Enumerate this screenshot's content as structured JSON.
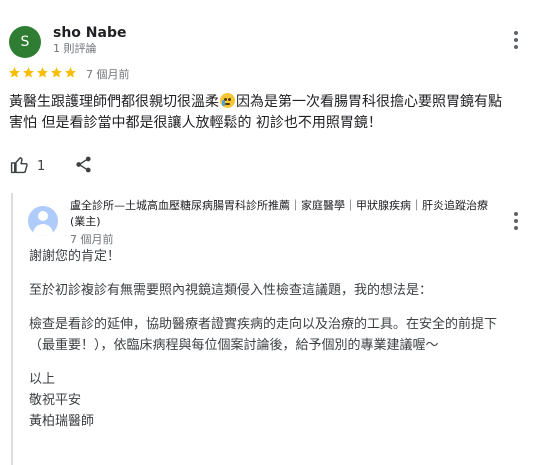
{
  "review": {
    "avatar_letter": "S",
    "avatar_color": "#2e7d32",
    "author_name": "sho Nabe",
    "author_meta": "1 則評論",
    "rating": 5,
    "rating_max": 5,
    "star_color": "#fbbc04",
    "time": "7 個月前",
    "text_part1": "黃醫生跟護理師們都很親切很溫柔",
    "emoji_icon": "crying-face-emoji",
    "text_part2": "因為是第一次看腸胃科很擔心要照胃鏡有點害怕 但是看診當中都是很讓人放輕鬆的 初診也不用照胃鏡！",
    "like_count": "1"
  },
  "owner_response": {
    "owner_name": "盧全診所—土城高血壓糖尿病腸胃科診所推薦｜家庭醫學｜甲狀腺疾病｜肝炎追蹤治療 (業主)",
    "time": "7 個月前",
    "paragraphs": [
      [
        "謝謝您的肯定！"
      ],
      [
        "至於初診複診有無需要照內視鏡這類侵入性檢查這議題，我的想法是："
      ],
      [
        "檢查是看診的延伸，協助醫療者證實疾病的走向以及治療的工具。在安全的前提下（最重要！），依臨床病程與每位個案討論後，給予個別的專業建議喔～"
      ],
      [
        "以上",
        "敬祝平安",
        "黃柏瑞醫師"
      ]
    ]
  },
  "icons": {
    "more": "more-vert-icon",
    "like": "thumb-up-icon",
    "share": "share-icon",
    "owner_avatar": "person-avatar-icon",
    "star": "star-icon"
  }
}
